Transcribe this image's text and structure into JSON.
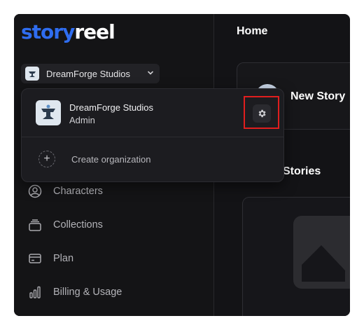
{
  "app": {
    "logo_part1": "story",
    "logo_part2": "reel"
  },
  "org_switcher": {
    "name": "DreamForge Studios"
  },
  "dropdown": {
    "org_name": "DreamForge Studios",
    "org_role": "Admin",
    "create_label": "Create organization",
    "plus_symbol": "+"
  },
  "sidebar": {
    "items": [
      {
        "label": "Characters",
        "icon": "user-circle-icon"
      },
      {
        "label": "Collections",
        "icon": "collection-icon"
      },
      {
        "label": "Plan",
        "icon": "credit-card-icon"
      },
      {
        "label": "Billing & Usage",
        "icon": "bar-chart-icon"
      }
    ]
  },
  "main": {
    "title": "Home",
    "new_story_label": "New Story",
    "stories_title": "Stories"
  },
  "colors": {
    "brand_blue": "#2f6df0",
    "highlight_red": "#e01e1e",
    "background": "#131316"
  }
}
